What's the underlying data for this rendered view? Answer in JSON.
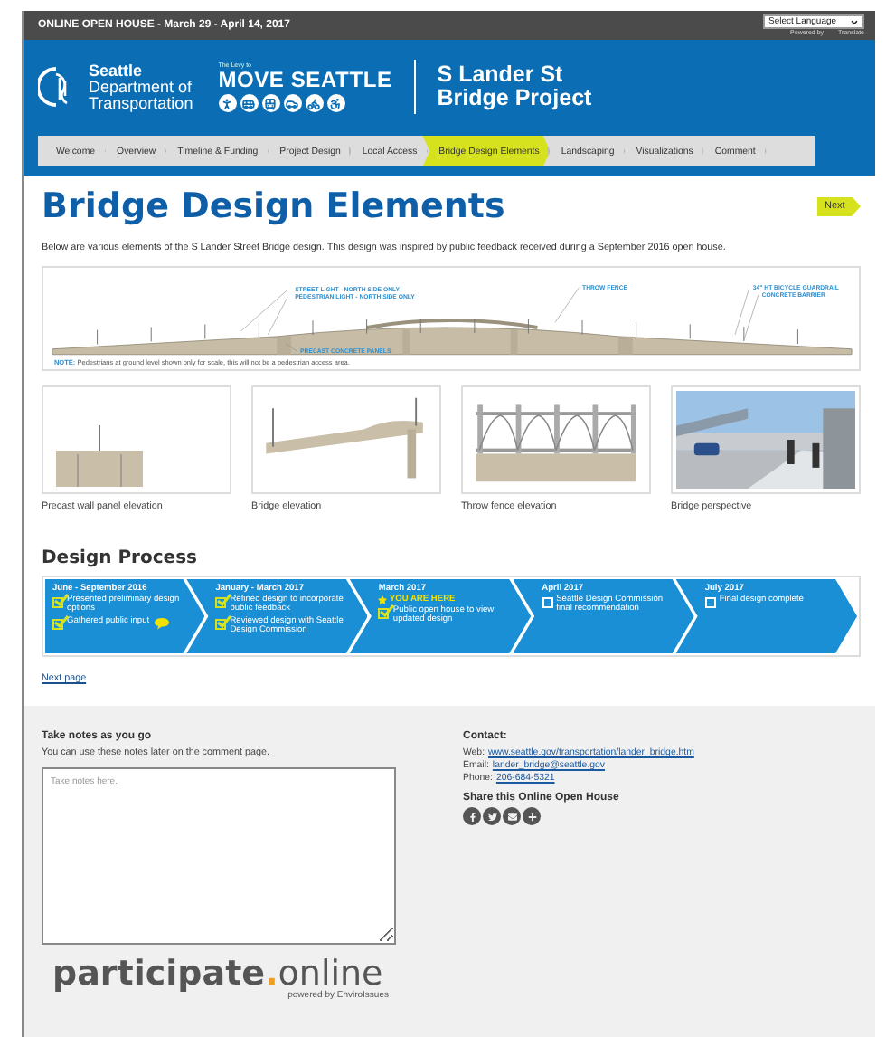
{
  "top_bar": {
    "title": "ONLINE OPEN HOUSE - March 29 - April 14, 2017",
    "language_select": "Select Language",
    "powered_by": "Powered by",
    "translate": "Translate"
  },
  "header": {
    "agency": [
      "Seattle",
      "Department of",
      "Transportation"
    ],
    "levy_tagline": "The Levy to",
    "levy_name": "MOVE SEATTLE",
    "project_title": [
      "S Lander St",
      "Bridge Project"
    ]
  },
  "nav": [
    {
      "label": "Welcome",
      "selected": false
    },
    {
      "label": "Overview",
      "selected": false
    },
    {
      "label": "Timeline & Funding",
      "selected": false
    },
    {
      "label": "Project Design",
      "selected": false
    },
    {
      "label": "Local Access",
      "selected": false
    },
    {
      "label": "Bridge Design Elements",
      "selected": true
    },
    {
      "label": "Landscaping",
      "selected": false
    },
    {
      "label": "Visualizations",
      "selected": false
    },
    {
      "label": "Comment",
      "selected": false
    }
  ],
  "page": {
    "title": "Bridge Design Elements",
    "next_button": "Next",
    "intro": "Below are various elements of the S Lander Street Bridge design. This design was inspired by public feedback received during a September 2016 open house."
  },
  "diagram": {
    "labels": [
      "STREET LIGHT - NORTH SIDE ONLY",
      "PEDESTRIAN LIGHT - NORTH SIDE ONLY",
      "THROW FENCE",
      "34\" HT BICYCLE GUARDRAIL",
      "CONCRETE BARRIER",
      "PRECAST CONCRETE PANELS"
    ],
    "note_label": "NOTE:",
    "note": "Pedestrians at ground level shown only for scale, this will not be a pedestrian access area."
  },
  "thumbnails": [
    {
      "kind": "wall",
      "caption": "Precast wall panel elevation"
    },
    {
      "kind": "bridge",
      "caption": "Bridge elevation"
    },
    {
      "kind": "fence",
      "caption": "Throw fence elevation"
    },
    {
      "kind": "picture",
      "caption": "Bridge perspective"
    }
  ],
  "process": {
    "title": "Design Process",
    "steps": [
      {
        "date": "June - September 2016",
        "items": [
          {
            "text": "Presented preliminary design options",
            "checked": true,
            "comment_icon": false
          },
          {
            "text": "Gathered public input",
            "checked": true,
            "comment_icon": true
          }
        ]
      },
      {
        "date": "January - March 2017",
        "items": [
          {
            "text": "Refined design to incorporate public feedback",
            "checked": true,
            "comment_icon": false
          },
          {
            "text": "Reviewed design with Seattle Design Commission",
            "checked": true,
            "comment_icon": false
          }
        ]
      },
      {
        "date": "March 2017",
        "highlight": "YOU ARE HERE",
        "items": [
          {
            "text": "Public open house to view updated design",
            "checked": true,
            "comment_icon": false
          }
        ]
      },
      {
        "date": "April 2017",
        "items": [
          {
            "text": "Seattle Design Commission final recommendation",
            "checked": false,
            "comment_icon": false
          }
        ]
      },
      {
        "date": "July 2017",
        "items": [
          {
            "text": "Final design complete",
            "checked": false,
            "comment_icon": false
          }
        ]
      }
    ]
  },
  "next_page_link": "Next page",
  "notes": {
    "title": "Take notes as you go",
    "subtitle": "You can use these notes later on the comment page.",
    "placeholder": "Take notes here."
  },
  "contact": {
    "title": "Contact:",
    "lines": [
      {
        "label": "Web:",
        "link": "www.seattle.gov/transportation/lander_bridge.htm"
      },
      {
        "label": "Email:",
        "link": "lander_bridge@seattle.gov"
      },
      {
        "label": "Phone:",
        "link": "206-684-5321"
      }
    ]
  },
  "share": {
    "title": "Share this Online Open House"
  },
  "footer_logo": {
    "main": "participate",
    "dot": ".",
    "suffix": "online",
    "powered": "powered by EnviroIssues"
  }
}
